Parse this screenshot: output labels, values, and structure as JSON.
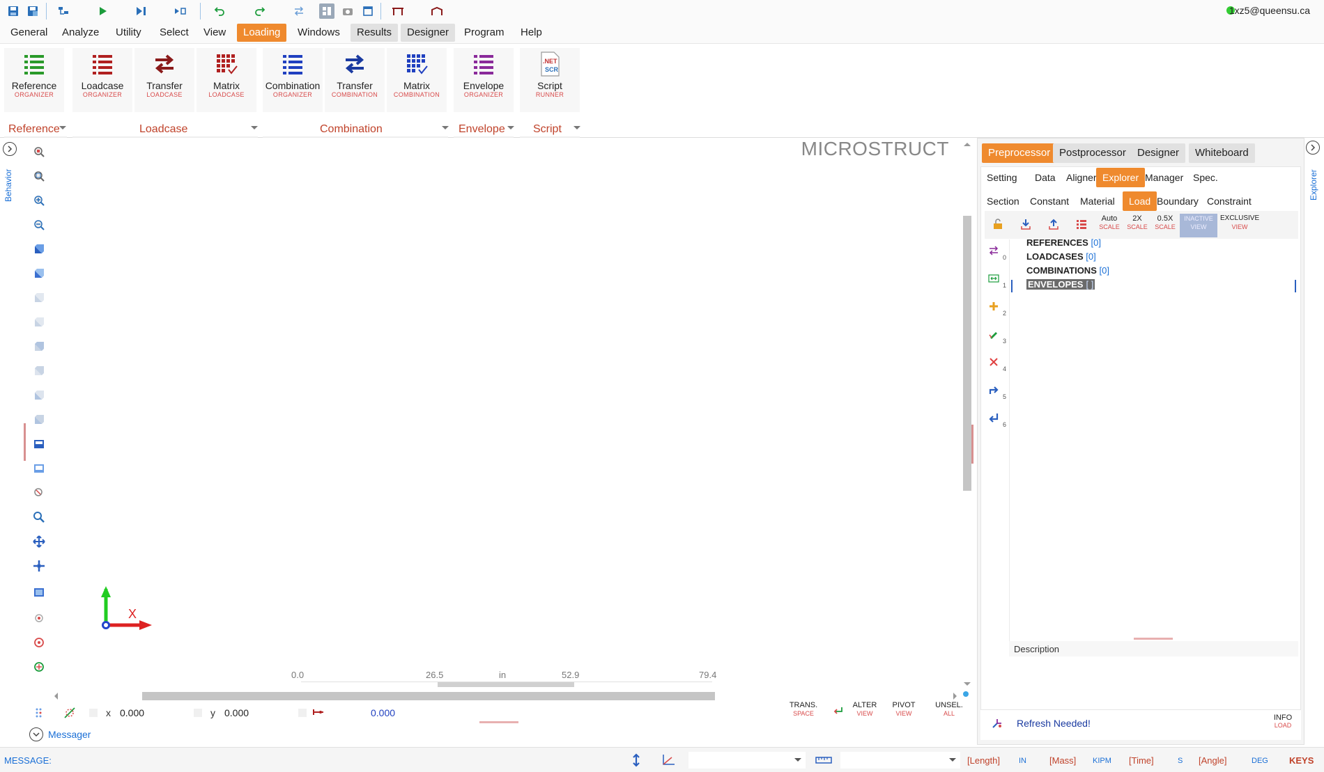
{
  "user": {
    "email": "1xz5@queensu.ca",
    "status_color": "#33cc33"
  },
  "menu": [
    "General",
    "Analyze",
    "Utility",
    "Select",
    "View",
    "Loading",
    "Windows",
    "Results",
    "Designer",
    "Program",
    "Help"
  ],
  "ribbon": {
    "buttons": [
      {
        "label": "Reference",
        "sub": "ORGANIZER",
        "icon": "list-icon",
        "color": "#2a9a2a"
      },
      {
        "label": "Loadcase",
        "sub": "ORGANIZER",
        "icon": "list-icon",
        "color": "#b02020"
      },
      {
        "label": "Transfer",
        "sub": "LOADCASE",
        "icon": "transfer-icon",
        "color": "#8a1a1a"
      },
      {
        "label": "Matrix",
        "sub": "LOADCASE",
        "icon": "matrix-icon",
        "color": "#b02020"
      },
      {
        "label": "Combination",
        "sub": "ORGANIZER",
        "icon": "list-icon",
        "color": "#2040c0"
      },
      {
        "label": "Transfer",
        "sub": "COMBINATION",
        "icon": "transfer-icon",
        "color": "#1a3aa0"
      },
      {
        "label": "Matrix",
        "sub": "COMBINATION",
        "icon": "matrix-icon",
        "color": "#2040c0"
      },
      {
        "label": "Envelope",
        "sub": "ORGANIZER",
        "icon": "list-icon",
        "color": "#8a2a9a"
      },
      {
        "label": "Script",
        "sub": "RUNNER",
        "icon": "script-icon",
        "color": "#c03030"
      }
    ],
    "groups": [
      "Reference",
      "Loadcase",
      "Combination",
      "Envelope",
      "Script"
    ],
    "script_icon_text": {
      "line1": ".NET",
      "line2": "SCR"
    }
  },
  "viewport": {
    "watermark": "MICROSTRUCT",
    "axis_label": "X",
    "ruler": [
      "0.0",
      "26.5",
      "in",
      "52.9",
      "79.4"
    ],
    "behavior_label": "Behavior"
  },
  "coords": {
    "x_label": "x",
    "x_value": "0.000",
    "y_label": "y",
    "y_value": "0.000",
    "d_value": "0.000"
  },
  "view_buttons": [
    {
      "a": "TRANS.",
      "b": "SPACE"
    },
    {
      "a": "ALTER",
      "b": "VIEW"
    },
    {
      "a": "PIVOT",
      "b": "VIEW"
    },
    {
      "a": "UNSEL.",
      "b": "ALL"
    }
  ],
  "messager": {
    "label": "Messager"
  },
  "right_panel": {
    "explorer_label": "Explorer",
    "top_tabs": [
      "Preprocessor",
      "Postprocessor",
      "Designer",
      "Whiteboard"
    ],
    "sub_tabs": [
      "Setting",
      "Data",
      "Aligner",
      "Explorer",
      "Manager",
      "Spec."
    ],
    "third_tabs": [
      "Section",
      "Constant",
      "Material",
      "Load",
      "Boundary",
      "Constraint"
    ],
    "scale_buttons": [
      {
        "a": "Auto",
        "b": "SCALE"
      },
      {
        "a": "2X",
        "b": "SCALE"
      },
      {
        "a": "0.5X",
        "b": "SCALE"
      },
      {
        "a": "INACTIVE",
        "b": "VIEW"
      },
      {
        "a": "EXCLUSIVE",
        "b": "VIEW"
      }
    ],
    "tree": [
      {
        "label": "REFERENCES",
        "count": "[0]"
      },
      {
        "label": "LOADCASES",
        "count": "[0]"
      },
      {
        "label": "COMBINATIONS",
        "count": "[0]"
      },
      {
        "label": "ENVELOPES",
        "count": "[ ]"
      }
    ],
    "side_numbers": [
      "0",
      "1",
      "2",
      "3",
      "4",
      "5",
      "6"
    ],
    "description_label": "Description",
    "refresh_label": "Refresh Needed!",
    "info": {
      "a": "INFO",
      "b": "LOAD"
    }
  },
  "statusbar": {
    "message_label": "MESSAGE:",
    "units": [
      {
        "k": "[Length]",
        "v": "IN"
      },
      {
        "k": "[Mass]",
        "v": "KIPM"
      },
      {
        "k": "[Time]",
        "v": "S"
      },
      {
        "k": "[Angle]",
        "v": "DEG"
      }
    ],
    "keys_label": "KEYS"
  },
  "colors": {
    "accent": "#ef8a2e",
    "link": "#1a6fd6",
    "sub_red": "#d84a4a"
  }
}
